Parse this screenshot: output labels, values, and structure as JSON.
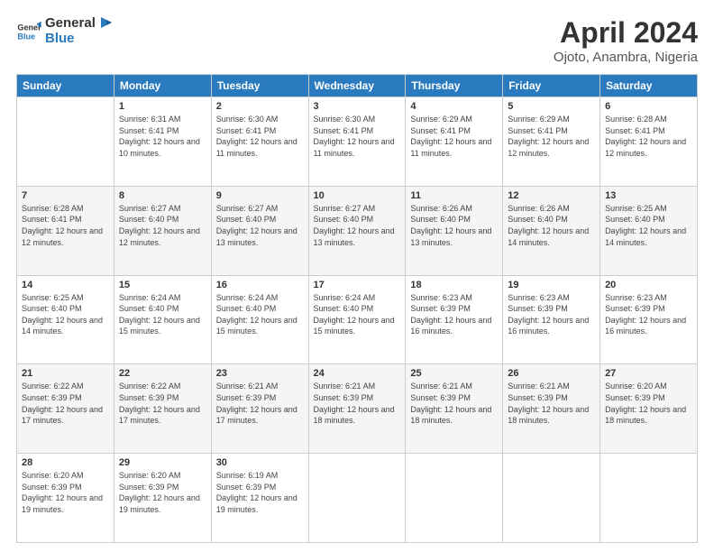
{
  "logo": {
    "general": "General",
    "blue": "Blue"
  },
  "title": "April 2024",
  "location": "Ojoto, Anambra, Nigeria",
  "days_of_week": [
    "Sunday",
    "Monday",
    "Tuesday",
    "Wednesday",
    "Thursday",
    "Friday",
    "Saturday"
  ],
  "weeks": [
    [
      {
        "day": "",
        "sunrise": "",
        "sunset": "",
        "daylight": ""
      },
      {
        "day": "1",
        "sunrise": "Sunrise: 6:31 AM",
        "sunset": "Sunset: 6:41 PM",
        "daylight": "Daylight: 12 hours and 10 minutes."
      },
      {
        "day": "2",
        "sunrise": "Sunrise: 6:30 AM",
        "sunset": "Sunset: 6:41 PM",
        "daylight": "Daylight: 12 hours and 11 minutes."
      },
      {
        "day": "3",
        "sunrise": "Sunrise: 6:30 AM",
        "sunset": "Sunset: 6:41 PM",
        "daylight": "Daylight: 12 hours and 11 minutes."
      },
      {
        "day": "4",
        "sunrise": "Sunrise: 6:29 AM",
        "sunset": "Sunset: 6:41 PM",
        "daylight": "Daylight: 12 hours and 11 minutes."
      },
      {
        "day": "5",
        "sunrise": "Sunrise: 6:29 AM",
        "sunset": "Sunset: 6:41 PM",
        "daylight": "Daylight: 12 hours and 12 minutes."
      },
      {
        "day": "6",
        "sunrise": "Sunrise: 6:28 AM",
        "sunset": "Sunset: 6:41 PM",
        "daylight": "Daylight: 12 hours and 12 minutes."
      }
    ],
    [
      {
        "day": "7",
        "sunrise": "Sunrise: 6:28 AM",
        "sunset": "Sunset: 6:41 PM",
        "daylight": "Daylight: 12 hours and 12 minutes."
      },
      {
        "day": "8",
        "sunrise": "Sunrise: 6:27 AM",
        "sunset": "Sunset: 6:40 PM",
        "daylight": "Daylight: 12 hours and 12 minutes."
      },
      {
        "day": "9",
        "sunrise": "Sunrise: 6:27 AM",
        "sunset": "Sunset: 6:40 PM",
        "daylight": "Daylight: 12 hours and 13 minutes."
      },
      {
        "day": "10",
        "sunrise": "Sunrise: 6:27 AM",
        "sunset": "Sunset: 6:40 PM",
        "daylight": "Daylight: 12 hours and 13 minutes."
      },
      {
        "day": "11",
        "sunrise": "Sunrise: 6:26 AM",
        "sunset": "Sunset: 6:40 PM",
        "daylight": "Daylight: 12 hours and 13 minutes."
      },
      {
        "day": "12",
        "sunrise": "Sunrise: 6:26 AM",
        "sunset": "Sunset: 6:40 PM",
        "daylight": "Daylight: 12 hours and 14 minutes."
      },
      {
        "day": "13",
        "sunrise": "Sunrise: 6:25 AM",
        "sunset": "Sunset: 6:40 PM",
        "daylight": "Daylight: 12 hours and 14 minutes."
      }
    ],
    [
      {
        "day": "14",
        "sunrise": "Sunrise: 6:25 AM",
        "sunset": "Sunset: 6:40 PM",
        "daylight": "Daylight: 12 hours and 14 minutes."
      },
      {
        "day": "15",
        "sunrise": "Sunrise: 6:24 AM",
        "sunset": "Sunset: 6:40 PM",
        "daylight": "Daylight: 12 hours and 15 minutes."
      },
      {
        "day": "16",
        "sunrise": "Sunrise: 6:24 AM",
        "sunset": "Sunset: 6:40 PM",
        "daylight": "Daylight: 12 hours and 15 minutes."
      },
      {
        "day": "17",
        "sunrise": "Sunrise: 6:24 AM",
        "sunset": "Sunset: 6:40 PM",
        "daylight": "Daylight: 12 hours and 15 minutes."
      },
      {
        "day": "18",
        "sunrise": "Sunrise: 6:23 AM",
        "sunset": "Sunset: 6:39 PM",
        "daylight": "Daylight: 12 hours and 16 minutes."
      },
      {
        "day": "19",
        "sunrise": "Sunrise: 6:23 AM",
        "sunset": "Sunset: 6:39 PM",
        "daylight": "Daylight: 12 hours and 16 minutes."
      },
      {
        "day": "20",
        "sunrise": "Sunrise: 6:23 AM",
        "sunset": "Sunset: 6:39 PM",
        "daylight": "Daylight: 12 hours and 16 minutes."
      }
    ],
    [
      {
        "day": "21",
        "sunrise": "Sunrise: 6:22 AM",
        "sunset": "Sunset: 6:39 PM",
        "daylight": "Daylight: 12 hours and 17 minutes."
      },
      {
        "day": "22",
        "sunrise": "Sunrise: 6:22 AM",
        "sunset": "Sunset: 6:39 PM",
        "daylight": "Daylight: 12 hours and 17 minutes."
      },
      {
        "day": "23",
        "sunrise": "Sunrise: 6:21 AM",
        "sunset": "Sunset: 6:39 PM",
        "daylight": "Daylight: 12 hours and 17 minutes."
      },
      {
        "day": "24",
        "sunrise": "Sunrise: 6:21 AM",
        "sunset": "Sunset: 6:39 PM",
        "daylight": "Daylight: 12 hours and 18 minutes."
      },
      {
        "day": "25",
        "sunrise": "Sunrise: 6:21 AM",
        "sunset": "Sunset: 6:39 PM",
        "daylight": "Daylight: 12 hours and 18 minutes."
      },
      {
        "day": "26",
        "sunrise": "Sunrise: 6:21 AM",
        "sunset": "Sunset: 6:39 PM",
        "daylight": "Daylight: 12 hours and 18 minutes."
      },
      {
        "day": "27",
        "sunrise": "Sunrise: 6:20 AM",
        "sunset": "Sunset: 6:39 PM",
        "daylight": "Daylight: 12 hours and 18 minutes."
      }
    ],
    [
      {
        "day": "28",
        "sunrise": "Sunrise: 6:20 AM",
        "sunset": "Sunset: 6:39 PM",
        "daylight": "Daylight: 12 hours and 19 minutes."
      },
      {
        "day": "29",
        "sunrise": "Sunrise: 6:20 AM",
        "sunset": "Sunset: 6:39 PM",
        "daylight": "Daylight: 12 hours and 19 minutes."
      },
      {
        "day": "30",
        "sunrise": "Sunrise: 6:19 AM",
        "sunset": "Sunset: 6:39 PM",
        "daylight": "Daylight: 12 hours and 19 minutes."
      },
      {
        "day": "",
        "sunrise": "",
        "sunset": "",
        "daylight": ""
      },
      {
        "day": "",
        "sunrise": "",
        "sunset": "",
        "daylight": ""
      },
      {
        "day": "",
        "sunrise": "",
        "sunset": "",
        "daylight": ""
      },
      {
        "day": "",
        "sunrise": "",
        "sunset": "",
        "daylight": ""
      }
    ]
  ]
}
